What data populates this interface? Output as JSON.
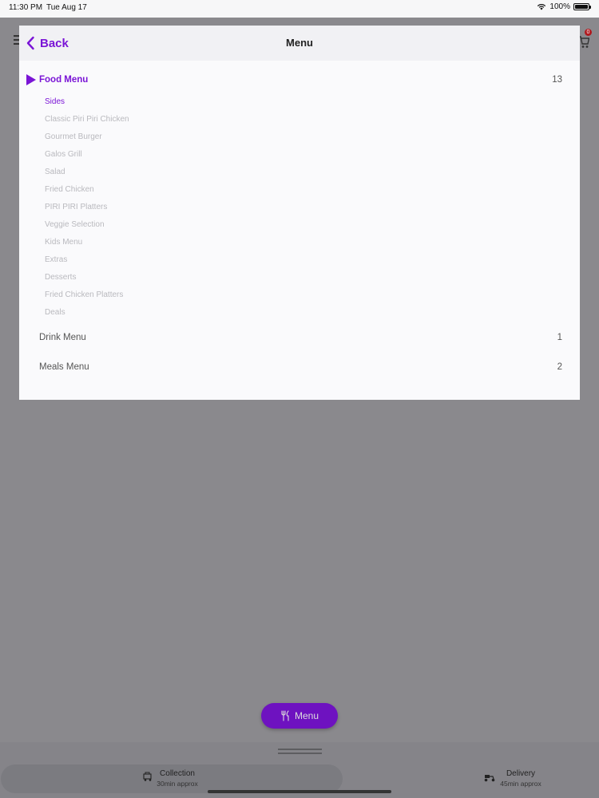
{
  "status_bar": {
    "time": "11:30 PM",
    "date": "Tue Aug 17",
    "battery": "100%"
  },
  "cart": {
    "badge": "0"
  },
  "modal": {
    "back_label": "Back",
    "title": "Menu",
    "accent_color": "#7a14d6"
  },
  "sections": [
    {
      "label": "Food Menu",
      "count": "13"
    },
    {
      "label": "Drink Menu",
      "count": "1"
    },
    {
      "label": "Meals Menu",
      "count": "2"
    }
  ],
  "food_menu_items": [
    "Sides",
    "Classic Piri Piri Chicken",
    "Gourmet Burger",
    "Galos Grill",
    "Salad",
    "Fried Chicken",
    "PIRI PIRI Platters",
    "Veggie Selection",
    "Kids Menu",
    "Extras",
    "Desserts",
    "Fried Chicken Platters",
    "Deals"
  ],
  "menu_button": {
    "label": "Menu"
  },
  "order_options": {
    "collection": {
      "label": "Collection",
      "time": "30min approx"
    },
    "delivery": {
      "label": "Delivery",
      "time": "45min approx"
    }
  }
}
